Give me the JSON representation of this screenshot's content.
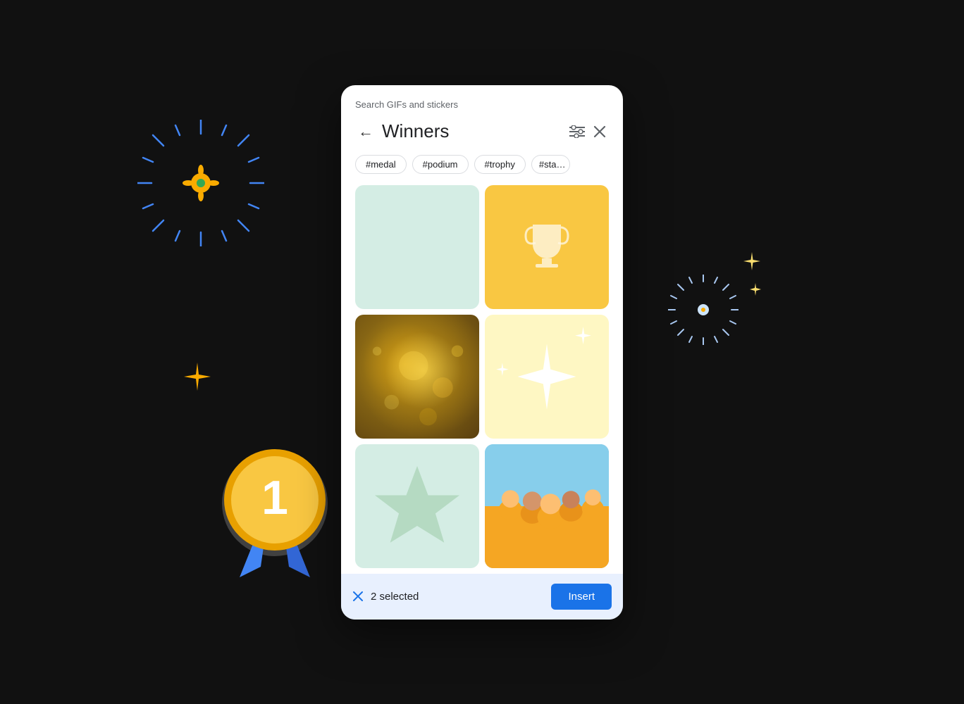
{
  "background": {
    "color": "#111111"
  },
  "dialog": {
    "search_label": "Search GIFs and stickers",
    "header": {
      "title": "Winners",
      "back_label": "←",
      "filter_label": "⚙",
      "close_label": "✕"
    },
    "tags": [
      "#medal",
      "#podium",
      "#trophy",
      "#sta…"
    ],
    "grid": [
      {
        "id": 1,
        "type": "solid_color",
        "color": "#d4ede4",
        "label": "green plain"
      },
      {
        "id": 2,
        "type": "trophy",
        "bg": "#f9c742",
        "label": "trophy"
      },
      {
        "id": 3,
        "type": "bokeh_gold",
        "label": "gold bokeh"
      },
      {
        "id": 4,
        "type": "sparkles",
        "bg": "#fef7c3",
        "label": "sparkles"
      },
      {
        "id": 5,
        "type": "star",
        "bg": "#d4ede4",
        "label": "star"
      },
      {
        "id": 6,
        "type": "photo_people",
        "label": "people celebrating"
      }
    ],
    "bottom_bar": {
      "clear_icon": "✕",
      "selected_text": "2 selected",
      "insert_label": "Insert"
    }
  },
  "decorations": {
    "starburst_blue": "blue starburst",
    "starburst_light": "light blue starburst",
    "sparkles_gold": "gold sparkle",
    "medal": "number 1 medal"
  }
}
